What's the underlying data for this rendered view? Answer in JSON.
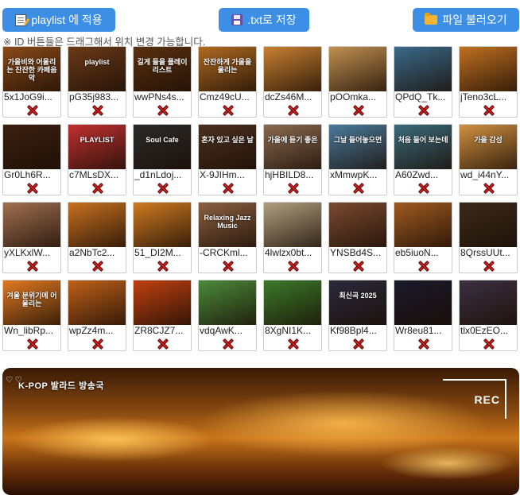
{
  "toolbar": {
    "apply_label": "playlist 에 적용",
    "save_label": ".txt로 저장",
    "load_label": "파일 불러오기"
  },
  "hint": "※ ID 버튼들은 드래그해서 위치 변경 가능합니다.",
  "cards": [
    {
      "id": "5x1JoG9i...",
      "thumb_text": "가을비와 어울리는 잔잔한 카페음악",
      "bg": "#8a4a18"
    },
    {
      "id": "pG35j983...",
      "thumb_text": "playlist",
      "bg": "#6a3a18"
    },
    {
      "id": "wwPNs4s...",
      "thumb_text": "길게 들을 플레이리스트",
      "bg": "#5a3010"
    },
    {
      "id": "Cmz49cU...",
      "thumb_text": "잔잔하게 가을을 울리는",
      "bg": "#b06a20"
    },
    {
      "id": "dcZs46M...",
      "thumb_text": "",
      "bg": "#c88030"
    },
    {
      "id": "pOOmka...",
      "thumb_text": "",
      "bg": "#c09050"
    },
    {
      "id": "QPdQ_Tk...",
      "thumb_text": "",
      "bg": "#3a6a8a"
    },
    {
      "id": "jTeno3cL...",
      "thumb_text": "",
      "bg": "#c07020"
    },
    {
      "id": "Gr0Lh6R...",
      "thumb_text": "",
      "bg": "#3a2010"
    },
    {
      "id": "c7MLsDX...",
      "thumb_text": "PLAYLIST",
      "bg": "#c03030"
    },
    {
      "id": "_d1nLdoj...",
      "thumb_text": "Soul Cafe",
      "bg": "#2a2a2a"
    },
    {
      "id": "X-9JIHm...",
      "thumb_text": "혼자 있고 싶은 날",
      "bg": "#4a3020"
    },
    {
      "id": "hjHBILD8...",
      "thumb_text": "가을에 듣기 좋은",
      "bg": "#8a6a50"
    },
    {
      "id": "xMmwpK...",
      "thumb_text": "그날 들어놓으면",
      "bg": "#4a7a9a"
    },
    {
      "id": "A60Zwd...",
      "thumb_text": "처음 들어 보는데",
      "bg": "#3a6a7a"
    },
    {
      "id": "wd_i44nY...",
      "thumb_text": "가을 감성",
      "bg": "#d09040"
    },
    {
      "id": "yXLKxlW...",
      "thumb_text": "",
      "bg": "#a07050"
    },
    {
      "id": "a2NbTc2...",
      "thumb_text": "",
      "bg": "#c87020"
    },
    {
      "id": "51_DI2M...",
      "thumb_text": "",
      "bg": "#d07a20"
    },
    {
      "id": "-CRCKml...",
      "thumb_text": "Relaxing Jazz Music",
      "bg": "#8a6040"
    },
    {
      "id": "4lwlzx0bt...",
      "thumb_text": "",
      "bg": "#b0a080"
    },
    {
      "id": "YNSBd4S...",
      "thumb_text": "",
      "bg": "#7a4a30"
    },
    {
      "id": "eb5iuoN...",
      "thumb_text": "",
      "bg": "#a05a20"
    },
    {
      "id": "8QrssUUt...",
      "thumb_text": "",
      "bg": "#3a2a1a"
    },
    {
      "id": "Wn_libRp...",
      "thumb_text": "겨울 분위기에 어울리는",
      "bg": "#e07a20"
    },
    {
      "id": "wpZz4m...",
      "thumb_text": "",
      "bg": "#c06018"
    },
    {
      "id": "ZR8CJZ7...",
      "thumb_text": "",
      "bg": "#c04010"
    },
    {
      "id": "vdqAwK...",
      "thumb_text": "",
      "bg": "#4a8a3a"
    },
    {
      "id": "8XgNI1K...",
      "thumb_text": "",
      "bg": "#3a7a2a"
    },
    {
      "id": "Kf98Bpl4...",
      "thumb_text": "최신곡 2025",
      "bg": "#2a2a3a"
    },
    {
      "id": "Wr8eu81...",
      "thumb_text": "",
      "bg": "#1a1a2a"
    },
    {
      "id": "tlx0EzEO...",
      "thumb_text": "",
      "bg": "#3a3040"
    }
  ],
  "player": {
    "title": "K-POP 발라드 방송국",
    "hearts": "♡ ♡",
    "rec_label": "REC"
  }
}
